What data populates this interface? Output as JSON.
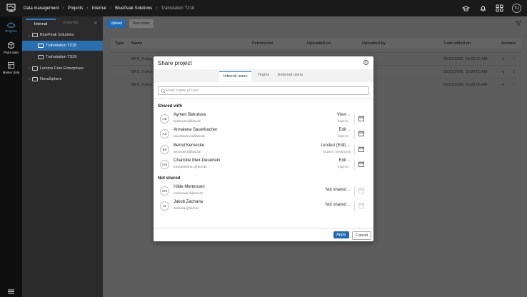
{
  "breadcrumb": [
    "Data management",
    "Projects",
    "Internal",
    "BluePeak Solutions",
    "Trafostation T218"
  ],
  "topbar": {
    "avatar": "TU"
  },
  "rail": [
    {
      "label": "Projects",
      "icon": "cloud-icon"
    },
    {
      "label": "Parts data",
      "icon": "cube-icon"
    },
    {
      "label": "Master data",
      "icon": "master-data-icon"
    }
  ],
  "tree": {
    "tabs": [
      "Internal",
      "External"
    ],
    "items": [
      {
        "label": "BluePeak Solutions"
      },
      {
        "label": "Trafostation T218"
      },
      {
        "label": "Trafostation TS20"
      },
      {
        "label": "Lumina Core Enterprises"
      },
      {
        "label": "NovaSphere"
      }
    ]
  },
  "toolbar": {
    "upload": "Upload",
    "new_folder": "New folder"
  },
  "grid": {
    "headers": [
      "Type",
      "Name",
      "Permission",
      "Uploaded on",
      "Uploaded by",
      "Last edited on",
      "Actions"
    ],
    "rows": [
      {
        "name": "BPS_Trafos",
        "edited": "05/21/2026, 10:20:00 AM"
      },
      {
        "name": "BPS_Trafos",
        "edited": "05/21/2026, 10:20:00 AM"
      },
      {
        "name": "BPS_Trafos",
        "edited": "05/21/2026, 10:20:00 AM"
      }
    ]
  },
  "modal": {
    "title": "Share project",
    "close": "×",
    "tabs": [
      "Internal users",
      "Teams",
      "External users"
    ],
    "search_placeholder": "Enter name of user",
    "shared_title": "Shared with",
    "not_shared_title": "Not shared",
    "shared": [
      {
        "initials": "AB",
        "name": "Aymen Bekulova",
        "email": "bekulova.a@test.de",
        "perm": "View",
        "expires": "Expires: -"
      },
      {
        "initials": "AS",
        "name": "Annalena Sauerbacher",
        "email": "sauerbacher.a@test.de",
        "perm": "Edit",
        "expires": "Expires: -"
      },
      {
        "initials": "BK",
        "name": "Bernd Kernecke",
        "email": "kernecke.b@test.de",
        "perm": "Limited (Edit)",
        "expires": "Expires: 04/08/2035"
      },
      {
        "initials": "CM",
        "name": "Charlotte Meir-Deuerlein",
        "email": "meirdeuerlein.c@test.de",
        "perm": "Edit",
        "expires": "Expires: -"
      }
    ],
    "not_shared": [
      {
        "initials": "HM",
        "name": "Hilde Mertensen",
        "email": "mertensen.h@test.de",
        "perm": "Not shared"
      },
      {
        "initials": "JZ",
        "name": "Jakob Zacharia",
        "email": "zacharia.j@test.de",
        "perm": "Not shared"
      }
    ],
    "apply": "Apply",
    "cancel": "Cancel"
  }
}
